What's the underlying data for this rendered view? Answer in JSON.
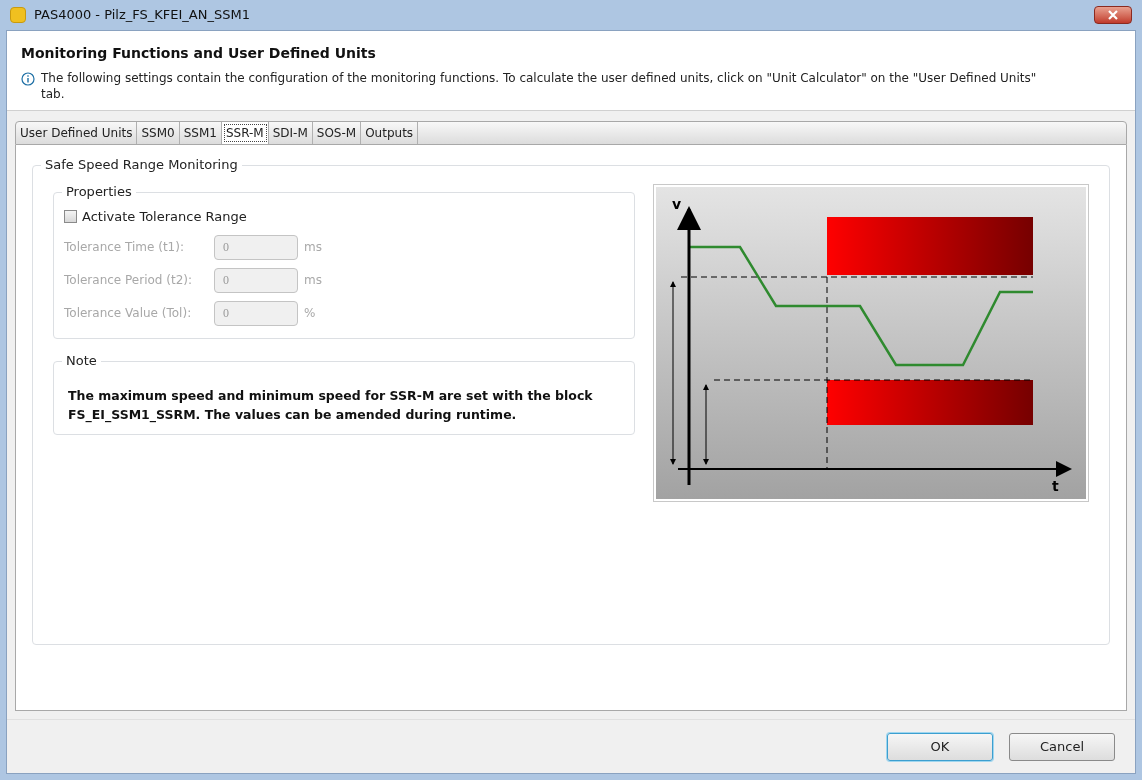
{
  "window": {
    "title": "PAS4000 - Pilz_FS_KFEI_AN_SSM1"
  },
  "header": {
    "title": "Monitoring Functions and User Defined Units",
    "info": "The following settings contain the configuration of the monitoring functions. To calculate the user defined units, click on \"Unit Calculator\" on the \"User Defined Units\" tab."
  },
  "tabs": [
    {
      "label": "User Defined Units",
      "selected": false
    },
    {
      "label": "SSM0",
      "selected": false
    },
    {
      "label": "SSM1",
      "selected": false
    },
    {
      "label": "SSR-M",
      "selected": true
    },
    {
      "label": "SDI-M",
      "selected": false
    },
    {
      "label": "SOS-M",
      "selected": false
    },
    {
      "label": "Outputs",
      "selected": false
    }
  ],
  "section": {
    "title": "Safe Speed Range Monitoring"
  },
  "properties": {
    "title": "Properties",
    "checkbox": {
      "label": "Activate Tolerance Range",
      "checked": false
    },
    "fields": [
      {
        "label": "Tolerance Time (t1):",
        "value": "0",
        "unit": "ms",
        "disabled": true
      },
      {
        "label": "Tolerance Period (t2):",
        "value": "0",
        "unit": "ms",
        "disabled": true
      },
      {
        "label": "Tolerance Value (Tol):",
        "value": "0",
        "unit": "%",
        "disabled": true
      }
    ]
  },
  "note": {
    "title": "Note",
    "text": "The maximum speed and minimum speed for SSR-M are set with the block FS_EI_SSM1_SSRM. The values can be amended during runtime."
  },
  "diagram": {
    "y_label": "v",
    "x_label": "t"
  },
  "buttons": [
    {
      "label": "OK",
      "default": true
    },
    {
      "label": "Cancel",
      "default": false
    }
  ]
}
